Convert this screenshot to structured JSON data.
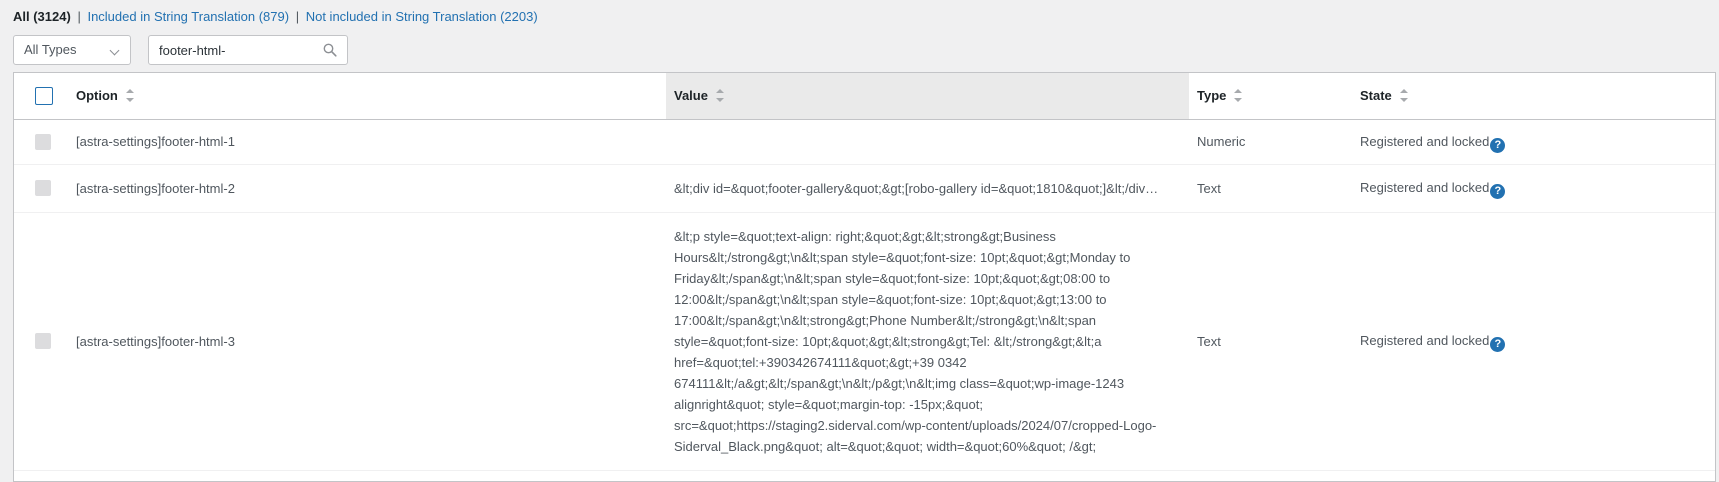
{
  "filters": {
    "all": "All (3124)",
    "separator": "|",
    "included": "Included in String Translation (879)",
    "not_included": "Not included in String Translation (2203)"
  },
  "type_select": {
    "value": "All Types",
    "icon": "chevron-down-icon"
  },
  "search": {
    "value": "footer-html-",
    "icon": "search-icon"
  },
  "table": {
    "headers": {
      "option": "Option",
      "value": "Value",
      "type": "Type",
      "state": "State"
    },
    "rows": [
      {
        "option": "[astra-settings]footer-html-1",
        "value": "",
        "type": "Numeric",
        "state": "Registered and locked",
        "help": "?"
      },
      {
        "option": "[astra-settings]footer-html-2",
        "value": "&lt;div id=&quot;footer-gallery&quot;&gt;[robo-gallery id=&quot;1810&quot;]&lt;/div…",
        "type": "Text",
        "state": "Registered and locked",
        "help": "?"
      },
      {
        "option": "[astra-settings]footer-html-3",
        "value": "&lt;p style=&quot;text-align: right;&quot;&gt;&lt;strong&gt;Business Hours&lt;/strong&gt;\\n&lt;span style=&quot;font-size: 10pt;&quot;&gt;Monday to Friday&lt;/span&gt;\\n&lt;span style=&quot;font-size: 10pt;&quot;&gt;08:00 to 12:00&lt;/span&gt;\\n&lt;span style=&quot;font-size: 10pt;&quot;&gt;13:00 to 17:00&lt;/span&gt;\\n&lt;strong&gt;Phone Number&lt;/strong&gt;\\n&lt;span style=&quot;font-size: 10pt;&quot;&gt;&lt;strong&gt;Tel: &lt;/strong&gt;&lt;a href=&quot;tel:+390342674111&quot;&gt;+39 0342 674111&lt;/a&gt;&lt;/span&gt;\\n&lt;/p&gt;\\n&lt;img class=&quot;wp-image-1243 alignright&quot; style=&quot;margin-top: -15px;&quot; src=&quot;https://staging2.siderval.com/wp-content/uploads/2024/07/cropped-Logo-Siderval_Black.png&quot; alt=&quot;&quot; width=&quot;60%&quot; /&gt;",
        "type": "Text",
        "state": "Registered and locked",
        "help": "?"
      }
    ]
  }
}
